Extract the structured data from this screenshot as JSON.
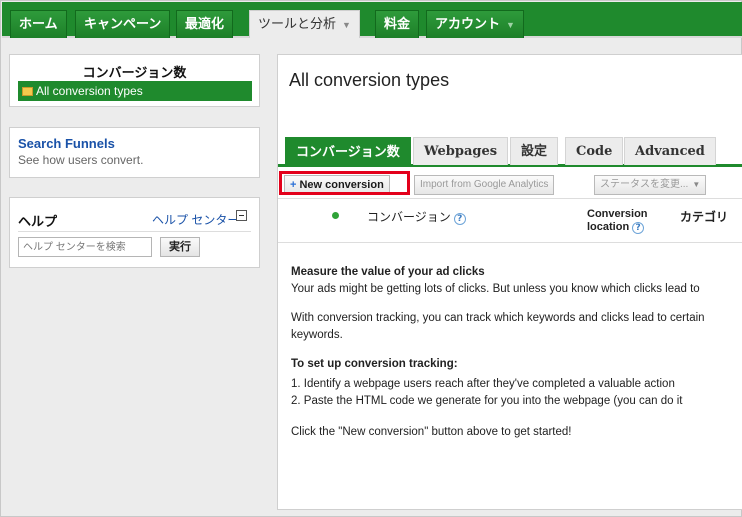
{
  "nav": {
    "tabs": [
      {
        "label": "ホーム",
        "has_caret": false,
        "active": false
      },
      {
        "label": "キャンペーン",
        "has_caret": false,
        "active": false
      },
      {
        "label": "最適化",
        "has_caret": false,
        "active": false
      },
      {
        "label": "ツールと分析",
        "has_caret": true,
        "active": true
      },
      {
        "label": "料金",
        "has_caret": false,
        "active": false
      },
      {
        "label": "アカウント",
        "has_caret": true,
        "active": false
      }
    ],
    "caret": "▼"
  },
  "sidebar": {
    "conversions": {
      "title": "コンバージョン数",
      "selected": "All conversion types"
    },
    "funnels": {
      "title": "Search Funnels",
      "subtitle": "See how users convert."
    },
    "help": {
      "title": "ヘルプ",
      "center_link": "ヘルプ センター",
      "search_placeholder": "ヘルプ センターを検索",
      "search_button": "実行"
    }
  },
  "main": {
    "page_title": "All conversion types",
    "tabs": [
      {
        "label": "コンバージョン数",
        "active": true
      },
      {
        "label": "Webpages",
        "active": false
      },
      {
        "label": "設定",
        "active": false
      },
      {
        "label": "Code",
        "active": false
      },
      {
        "label": "Advanced",
        "active": false
      }
    ],
    "toolbar": {
      "new_conversion": "New conversion",
      "import_ga": "Import from Google Analytics",
      "status_change": "ステータスを変更..."
    },
    "columns": {
      "conversion": "コンバージョン",
      "location_line1": "Conversion",
      "location_line2": "location",
      "category": "カテゴリ"
    },
    "intro": {
      "heading": "Measure the value of your ad clicks",
      "line1": "Your ads might be getting lots of clicks. But unless you know which clicks lead to",
      "line2": "With conversion tracking, you can track which keywords and clicks lead to certain",
      "line3": "keywords.",
      "setup_heading": "To set up conversion tracking:",
      "step1": "1.  Identify a webpage users reach after they've completed a valuable action",
      "step2": "2.  Paste the HTML code we generate for you into the webpage (you can do it",
      "cta": "Click the \"New conversion\" button above to get started!"
    }
  },
  "colors": {
    "brand_green": "#1f8a2d",
    "link_blue": "#1a52a8",
    "highlight_red": "#e3001b"
  }
}
